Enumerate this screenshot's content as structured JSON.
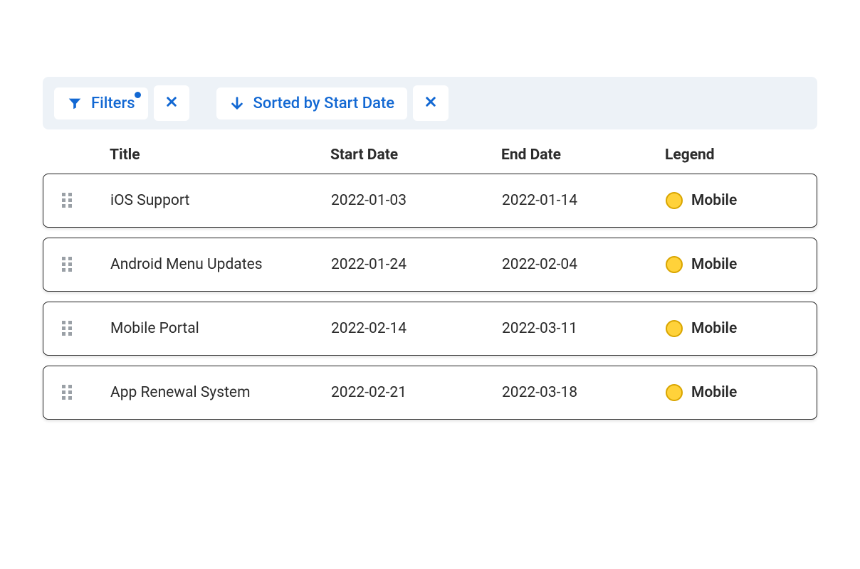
{
  "toolbar": {
    "filters_label": "Filters",
    "filters_active": true,
    "sort_label": "Sorted by Start Date"
  },
  "columns": {
    "title": "Title",
    "start_date": "Start Date",
    "end_date": "End Date",
    "legend": "Legend"
  },
  "legend": {
    "mobile": {
      "label": "Mobile",
      "color": "#ffd23a"
    }
  },
  "rows": [
    {
      "title": "iOS Support",
      "start_date": "2022-01-03",
      "end_date": "2022-01-14",
      "legend": "Mobile"
    },
    {
      "title": "Android Menu Updates",
      "start_date": "2022-01-24",
      "end_date": "2022-02-04",
      "legend": "Mobile"
    },
    {
      "title": "Mobile Portal",
      "start_date": "2022-02-14",
      "end_date": "2022-03-11",
      "legend": "Mobile"
    },
    {
      "title": "App Renewal System",
      "start_date": "2022-02-21",
      "end_date": "2022-03-18",
      "legend": "Mobile"
    }
  ]
}
